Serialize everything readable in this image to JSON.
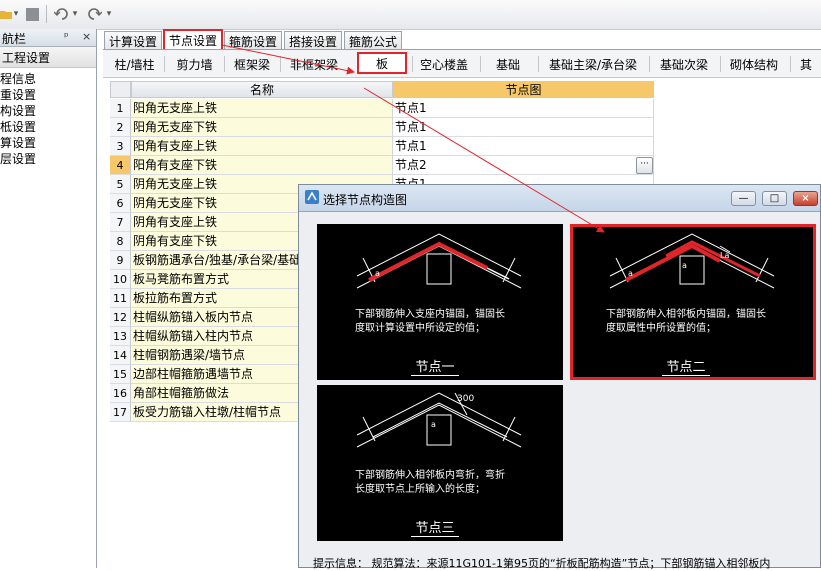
{
  "toolbar": {
    "undo_icon": "undo-icon",
    "redo_icon": "redo-icon"
  },
  "left_panel": {
    "title": "航栏",
    "pin_glyph": "ᵖ",
    "close_glyph": "×",
    "group_label": "工程设置",
    "items": [
      "程信息",
      "重设置",
      "构设置",
      "柢设置",
      "算设置",
      "层设置"
    ]
  },
  "tabs": [
    "计算设置",
    "节点设置",
    "箍筋设置",
    "搭接设置",
    "箍筋公式"
  ],
  "active_tab": "节点设置",
  "subtabs": [
    "柱/墙柱",
    "剪力墙",
    "框架梁",
    "非框架梁",
    "板",
    "空心楼盖",
    "基础",
    "基础主梁/承台梁",
    "基础次梁",
    "砌体结构",
    "其"
  ],
  "active_subtab": "板",
  "grid": {
    "col_name": "名称",
    "col_diagram": "节点图",
    "rows": [
      {
        "no": "1",
        "name": "阳角无支座上铁",
        "value": "节点1"
      },
      {
        "no": "2",
        "name": "阳角无支座下铁",
        "value": "节点1"
      },
      {
        "no": "3",
        "name": "阳角有支座上铁",
        "value": "节点1"
      },
      {
        "no": "4",
        "name": "阳角有支座下铁",
        "value": "节点2"
      },
      {
        "no": "5",
        "name": "阴角无支座上铁",
        "value": "节点1"
      },
      {
        "no": "6",
        "name": "阴角无支座下铁",
        "value": ""
      },
      {
        "no": "7",
        "name": "阴角有支座上铁",
        "value": ""
      },
      {
        "no": "8",
        "name": "阴角有支座下铁",
        "value": ""
      },
      {
        "no": "9",
        "name": "板钢筋遇承台/独基/承台梁/基础",
        "value": ""
      },
      {
        "no": "10",
        "name": "板马凳筋布置方式",
        "value": ""
      },
      {
        "no": "11",
        "name": "板拉筋布置方式",
        "value": ""
      },
      {
        "no": "12",
        "name": "柱帽纵筋锚入板内节点",
        "value": ""
      },
      {
        "no": "13",
        "name": "柱帽纵筋锚入柱内节点",
        "value": ""
      },
      {
        "no": "14",
        "name": "柱帽钢筋遇梁/墙节点",
        "value": ""
      },
      {
        "no": "15",
        "name": "边部柱帽箍筋遇墙节点",
        "value": ""
      },
      {
        "no": "16",
        "name": "角部柱帽箍筋做法",
        "value": ""
      },
      {
        "no": "17",
        "name": "板受力筋锚入柱墩/柱帽节点",
        "value": ""
      }
    ],
    "ellipsis": "···"
  },
  "dialog": {
    "title": "选择节点构造图",
    "min_glyph": "—",
    "max_glyph": "□",
    "close_glyph": "×",
    "nodes": [
      {
        "caption": "节点一",
        "line1": "下部钢筋伸入支座内锚固，锚固长",
        "line2": "度取计算设置中所设定的值；"
      },
      {
        "caption": "节点二",
        "line1": "下部钢筋伸入相邻板内锚固，锚固长",
        "line2": "度取属性中所设置的值；",
        "label_a": "a",
        "label_la": "La"
      },
      {
        "caption": "节点三",
        "line1": "下部钢筋伸入相邻板内弯折，弯折",
        "line2": "长度取节点上所输入的长度；",
        "label_300": "300",
        "label_a": "a"
      }
    ],
    "hint": "提示信息： 规范算法：来源11G101-1第95页的“折板配筋构造”节点；下部钢筋锚入相邻板内"
  },
  "colors": {
    "highlight_red": "#e0262b",
    "header_orange": "#f6c86a",
    "name_cell_yellow": "#fcfcdc"
  }
}
